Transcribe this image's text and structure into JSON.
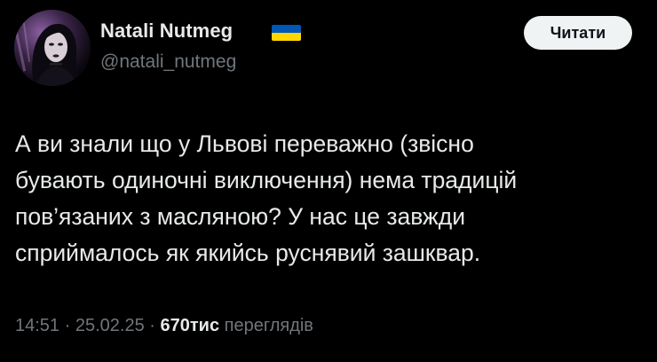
{
  "author": {
    "display_name": "Natali Nutmeg",
    "username": "@natali_nutmeg",
    "flag": {
      "name": "ukraine-flag",
      "colors": [
        "#0057b7",
        "#ffd700"
      ]
    }
  },
  "follow_button": {
    "label": "Читати"
  },
  "tweet": {
    "lines": [
      "А ви знали що у Львові переважно (звісно",
      "бувають одиночні виключення) нема традицій",
      "пов’язаних з масляною? У нас це завжди",
      "сприймалось як якийсь руснявий зашквар."
    ]
  },
  "meta": {
    "time": "14:51",
    "separator": " · ",
    "date": "25.02.25",
    "views_count": "670тис",
    "views_label": "переглядів"
  },
  "colors": {
    "background": "#000000",
    "text_primary": "#e7e9ea",
    "text_secondary": "#71767b",
    "button_bg": "#eff3f4"
  }
}
